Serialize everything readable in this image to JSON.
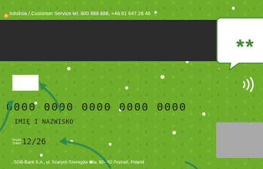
{
  "card": {
    "infoline": "Infolinia / Customer Service tel. 800 888 888, +48 61 647 28 46",
    "card_number": "0000 0000 0000 0000 0000",
    "holder_name": "IMIĘ I NAZWISKO",
    "valid_thru_label": "VALID THRU",
    "expiry": "12/26",
    "bank_address": "SGB-Bank S.A., ul. Szarych Szeregów 23a, 60-462 Poznań, Poland",
    "callout_text": "**"
  },
  "colors": {
    "grass": "#6fae2a",
    "magnetic_stripe": "#2b2b2b",
    "arrow": "#2f8a54",
    "callout_text": "#3a8a2c",
    "chip": "#a8a8a8"
  },
  "icons": {
    "logo": "orange-flower-logo-icon",
    "contactless": "contactless-icon",
    "arrows": "curved-arrow-icon"
  }
}
